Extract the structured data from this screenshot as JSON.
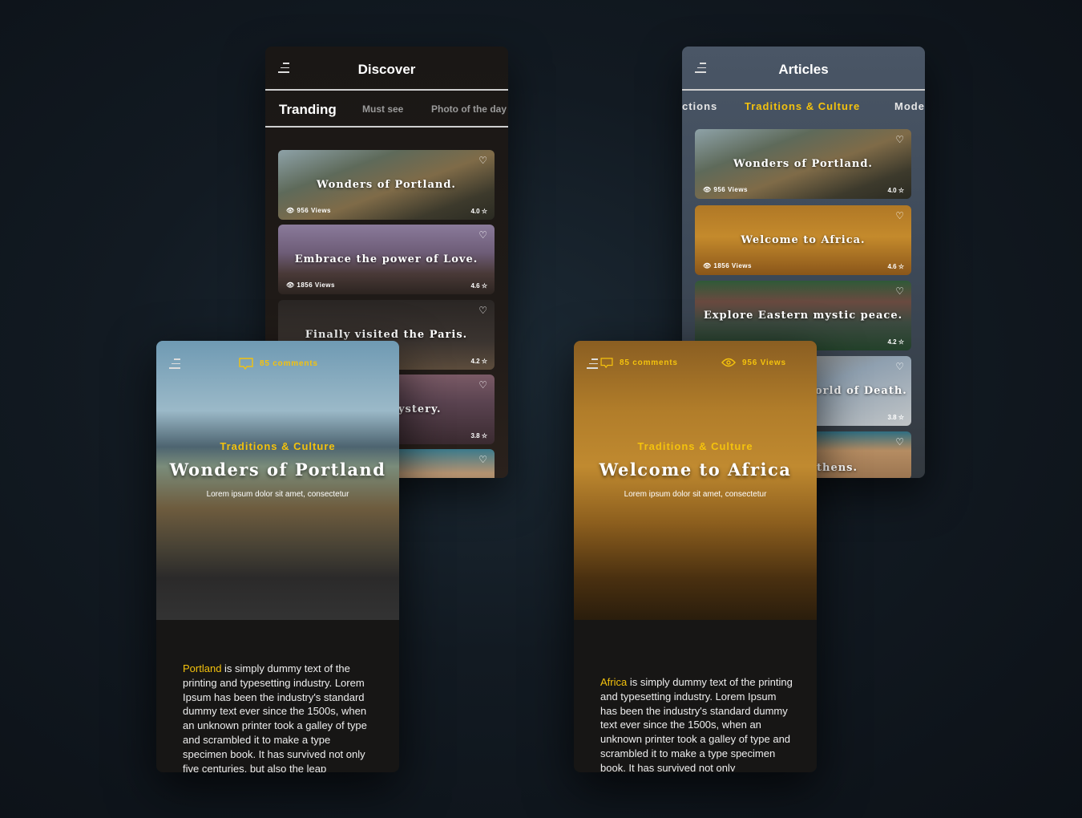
{
  "discover": {
    "title": "Discover",
    "tabs": [
      "Tranding",
      "Must see",
      "Photo of the day"
    ],
    "cards": [
      {
        "title": "Wonders of Portland.",
        "views": "956 Views",
        "rating": "4.0",
        "bg": "linear-gradient(160deg,#8ea2a8 0%,#5e6a5a 30%,#7f6b48 55%,#3d3a2c 80%,#2a2a22 100%)"
      },
      {
        "title": "Embrace the power of Love.",
        "views": "1856 Views",
        "rating": "4.6",
        "bg": "linear-gradient(180deg,#8a7a9a 0%,#6e5d78 40%,#4a3a38 70%,#2c2420 100%)"
      },
      {
        "title": "Finally visited the Paris.",
        "views": "",
        "rating": "4.2",
        "bg": "linear-gradient(180deg,#2a2624 0%,#3b3430 60%,#5c4c3c 100%)"
      },
      {
        "title": "ystery.",
        "views": "",
        "rating": "3.8",
        "bg": "linear-gradient(180deg,#7a5a66 0%,#5a4350 40%,#3a2a30 100%)"
      },
      {
        "title": "",
        "views": "",
        "rating": "",
        "bg": "linear-gradient(180deg,#3b7a8c 0%,#b39270 50%,#9a7a5a 100%)"
      }
    ]
  },
  "articles": {
    "title": "Articles",
    "tabs": [
      "ctions",
      "Traditions & Culture",
      "Moder"
    ],
    "cards": [
      {
        "title": "Wonders of Portland.",
        "views": "956 Views",
        "rating": "4.0",
        "bg": "linear-gradient(160deg,#8ea2a8 0%,#5e6a5a 30%,#7f6b48 55%,#3d3a2c 80%,#2a2a22 100%)"
      },
      {
        "title": "Welcome to Africa.",
        "views": "1856 Views",
        "rating": "4.6",
        "bg": "linear-gradient(180deg,#b07826 0%,#c48a2c 45%,#8a561a 100%)"
      },
      {
        "title": "Explore Eastern mystic peace.",
        "views": "",
        "rating": "4.2",
        "bg": "linear-gradient(180deg,#2f5a38 0%,#6a4a40 30%,#3c4a40 60%,#23412a 100%)"
      },
      {
        "title": "orld of Death.",
        "views": "",
        "rating": "3.8",
        "bg": "linear-gradient(160deg,#7a6a58 0%,#8fa0b0 50%,#c0c4c6 100%)"
      },
      {
        "title": "thens.",
        "views": "",
        "rating": "",
        "bg": "linear-gradient(180deg,#2f6e82 0%,#b58c62 40%,#9a7450 100%)"
      }
    ]
  },
  "portland": {
    "category": "Traditions & Culture",
    "title": "Wonders of Portland",
    "subtitle": "Lorem ipsum dolor sit amet, consectetur",
    "comments": "85 comments",
    "highlight": "Portland",
    "body": " is simply dummy text of the printing and typesetting industry. Lorem Ipsum has been the industry's standard dummy text ever since the 1500s, when an unknown printer took a galley of type and scrambled it to make a type specimen book. It has survived not only five centuries, but also the leap"
  },
  "africa": {
    "category": "Traditions & Culture",
    "title": "Welcome to Africa",
    "subtitle": "Lorem ipsum dolor sit amet, consectetur",
    "comments": "85 comments",
    "views": "956 Views",
    "highlight": "Africa",
    "body": " is simply dummy text of the printing and typesetting industry. Lorem Ipsum has been the industry's standard dummy text ever since the 1500s, when an unknown printer took a galley of type and scrambled it to make a type specimen book. It has survived not only"
  },
  "colors": {
    "accent": "#f4c20d"
  },
  "icons": [
    "menu-icon",
    "heart-icon",
    "eye-icon",
    "star-icon",
    "comment-icon"
  ]
}
